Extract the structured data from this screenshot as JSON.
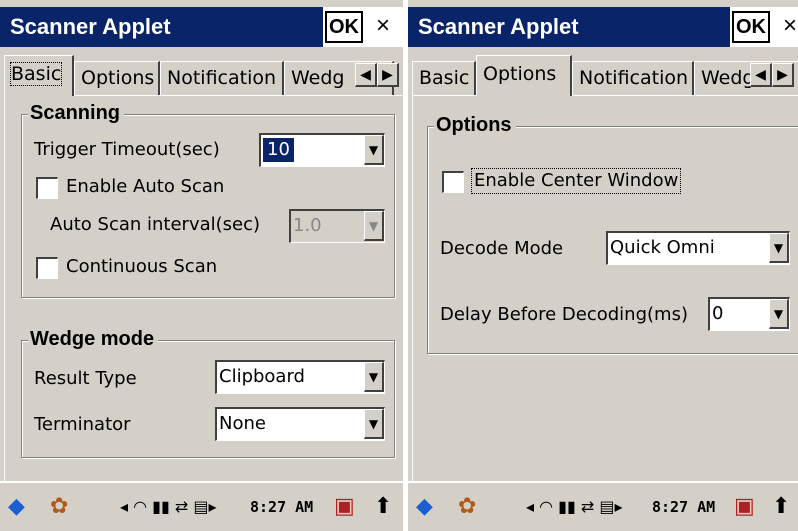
{
  "left": {
    "title": "Scanner Applet",
    "ok_label": "OK",
    "close_label": "×",
    "tabs": [
      "Basic",
      "Options",
      "Notification",
      "Wedg"
    ],
    "active_tab": "Basic",
    "scanning": {
      "group_title": "Scanning",
      "trigger_timeout_label": "Trigger Timeout(sec)",
      "trigger_timeout_value": "10",
      "enable_auto_scan_label": "Enable Auto Scan",
      "auto_scan_interval_label": "Auto Scan interval(sec)",
      "auto_scan_interval_value": "1.0",
      "continuous_scan_label": "Continuous Scan"
    },
    "wedge": {
      "group_title": "Wedge mode",
      "result_type_label": "Result Type",
      "result_type_value": "Clipboard",
      "terminator_label": "Terminator",
      "terminator_value": "None"
    }
  },
  "right": {
    "title": "Scanner Applet",
    "ok_label": "OK",
    "close_label": "×",
    "tabs": [
      "Basic",
      "Options",
      "Notification",
      "Wedg"
    ],
    "active_tab": "Options",
    "options": {
      "group_title": "Options",
      "enable_center_window_label": "Enable Center Window",
      "decode_mode_label": "Decode Mode",
      "decode_mode_value": "Quick Omni",
      "delay_label": "Delay Before Decoding(ms)",
      "delay_value": "0"
    }
  },
  "taskbar": {
    "time": "8:27 AM",
    "icons": [
      "start-icon",
      "applet-icon",
      "wifi-icon",
      "signal-icon",
      "sync-icon",
      "battery-icon",
      "keyboard-icon",
      "up-arrow-icon"
    ]
  },
  "colors": {
    "titlebar": "#0a246a",
    "face": "#d4d0c8",
    "selection": "#0a246a"
  }
}
